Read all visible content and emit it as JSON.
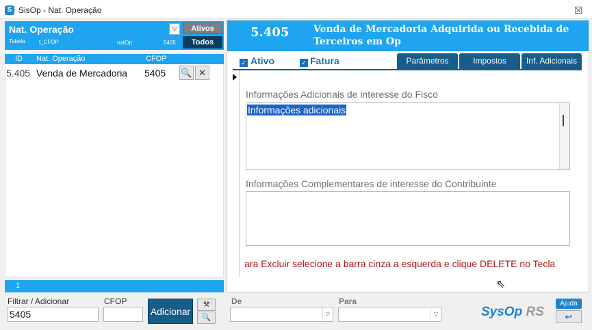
{
  "window": {
    "app_icon": "S",
    "title": "SisOp - Nat. Operação",
    "close_glyph": "☒"
  },
  "left_panel": {
    "title": "Nat. Operação",
    "dropdown_glyph": "▽",
    "meta": {
      "tabela_label": "Tabela",
      "tabela_value": "t_CFOP",
      "field": "natOp",
      "value": "5405"
    },
    "ativos_label": "Ativos",
    "todos_label": "Todos",
    "columns": [
      "ID",
      "Nat. Operação",
      "CFOP"
    ],
    "rows": [
      {
        "id": "5.405",
        "nat_op": "Venda de Mercadoria",
        "cfop": "5405"
      }
    ],
    "row_buttons": {
      "view_glyph": "🔍",
      "delete_glyph": "✕"
    },
    "record_count": "1"
  },
  "filter": {
    "label": "Filtrar / Adicionar",
    "value": "5405",
    "cfop_label": "CFOP",
    "cfop_value": "",
    "add_label": "Adicionar",
    "tool1_glyph": "⚒",
    "tool2_glyph": "🔍"
  },
  "detail": {
    "code": "5.405",
    "description": "Venda de Mercadoria Adquirida ou Recebida de Terceiros em Op",
    "ativo_label": "Ativo",
    "ativo_checked": true,
    "fatura_label": "Fatura",
    "fatura_checked": true,
    "check_glyph": "✓",
    "tabs": [
      "Parâmetros",
      "Impostos",
      "Inf. Adicionais"
    ],
    "active_tab": "Inf. Adicionais",
    "fisco_label": "Informações Adicionais de interesse do Fisco",
    "fisco_value": "Informações adicionais",
    "contrib_label": "Informações Complementares de interesse do Contribuinte",
    "contrib_value": "",
    "warning": "ara Excluir selecione a barra cinza a esquerda e clique DELETE no Tecla"
  },
  "bottom": {
    "de_label": "De",
    "para_label": "Para",
    "combo_arrow_glyph": "▽",
    "logo_main": "SysOp",
    "logo_suffix": " RS",
    "ajuda_label": "Ajuda",
    "back_glyph": "↩",
    "cursor_glyph": "⇖"
  },
  "colors": {
    "accent": "#1fa4f0",
    "dark_button": "#165d8a",
    "warning": "#b01818"
  }
}
